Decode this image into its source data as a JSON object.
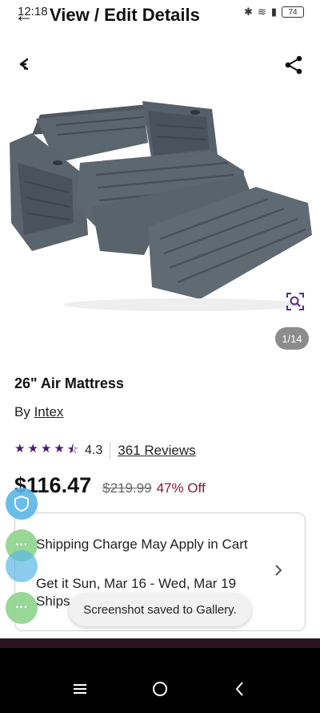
{
  "status": {
    "time": "12:18",
    "battery": "74"
  },
  "header": {
    "title": "View / Edit Details"
  },
  "product": {
    "image_counter": "1/14",
    "title": "26\" Air Mattress",
    "by_prefix": "By",
    "brand": "Intex",
    "rating": "4.3",
    "reviews": "361 Reviews",
    "price": "$116.47",
    "old_price": "$219.99",
    "discount": "47% Off"
  },
  "shipping": {
    "line1": "Shipping Charge May Apply in Cart",
    "line2": "Get it Sun, Mar 16 - Wed, Mar 19",
    "line3": "Ships"
  },
  "toast": {
    "text": "Screenshot saved to Gallery."
  },
  "colors": {
    "accent": "#4a1a6b",
    "discount": "#8b1a3a",
    "bubble_green": "#8fd38c",
    "bubble_blue": "#5ab6e6"
  }
}
